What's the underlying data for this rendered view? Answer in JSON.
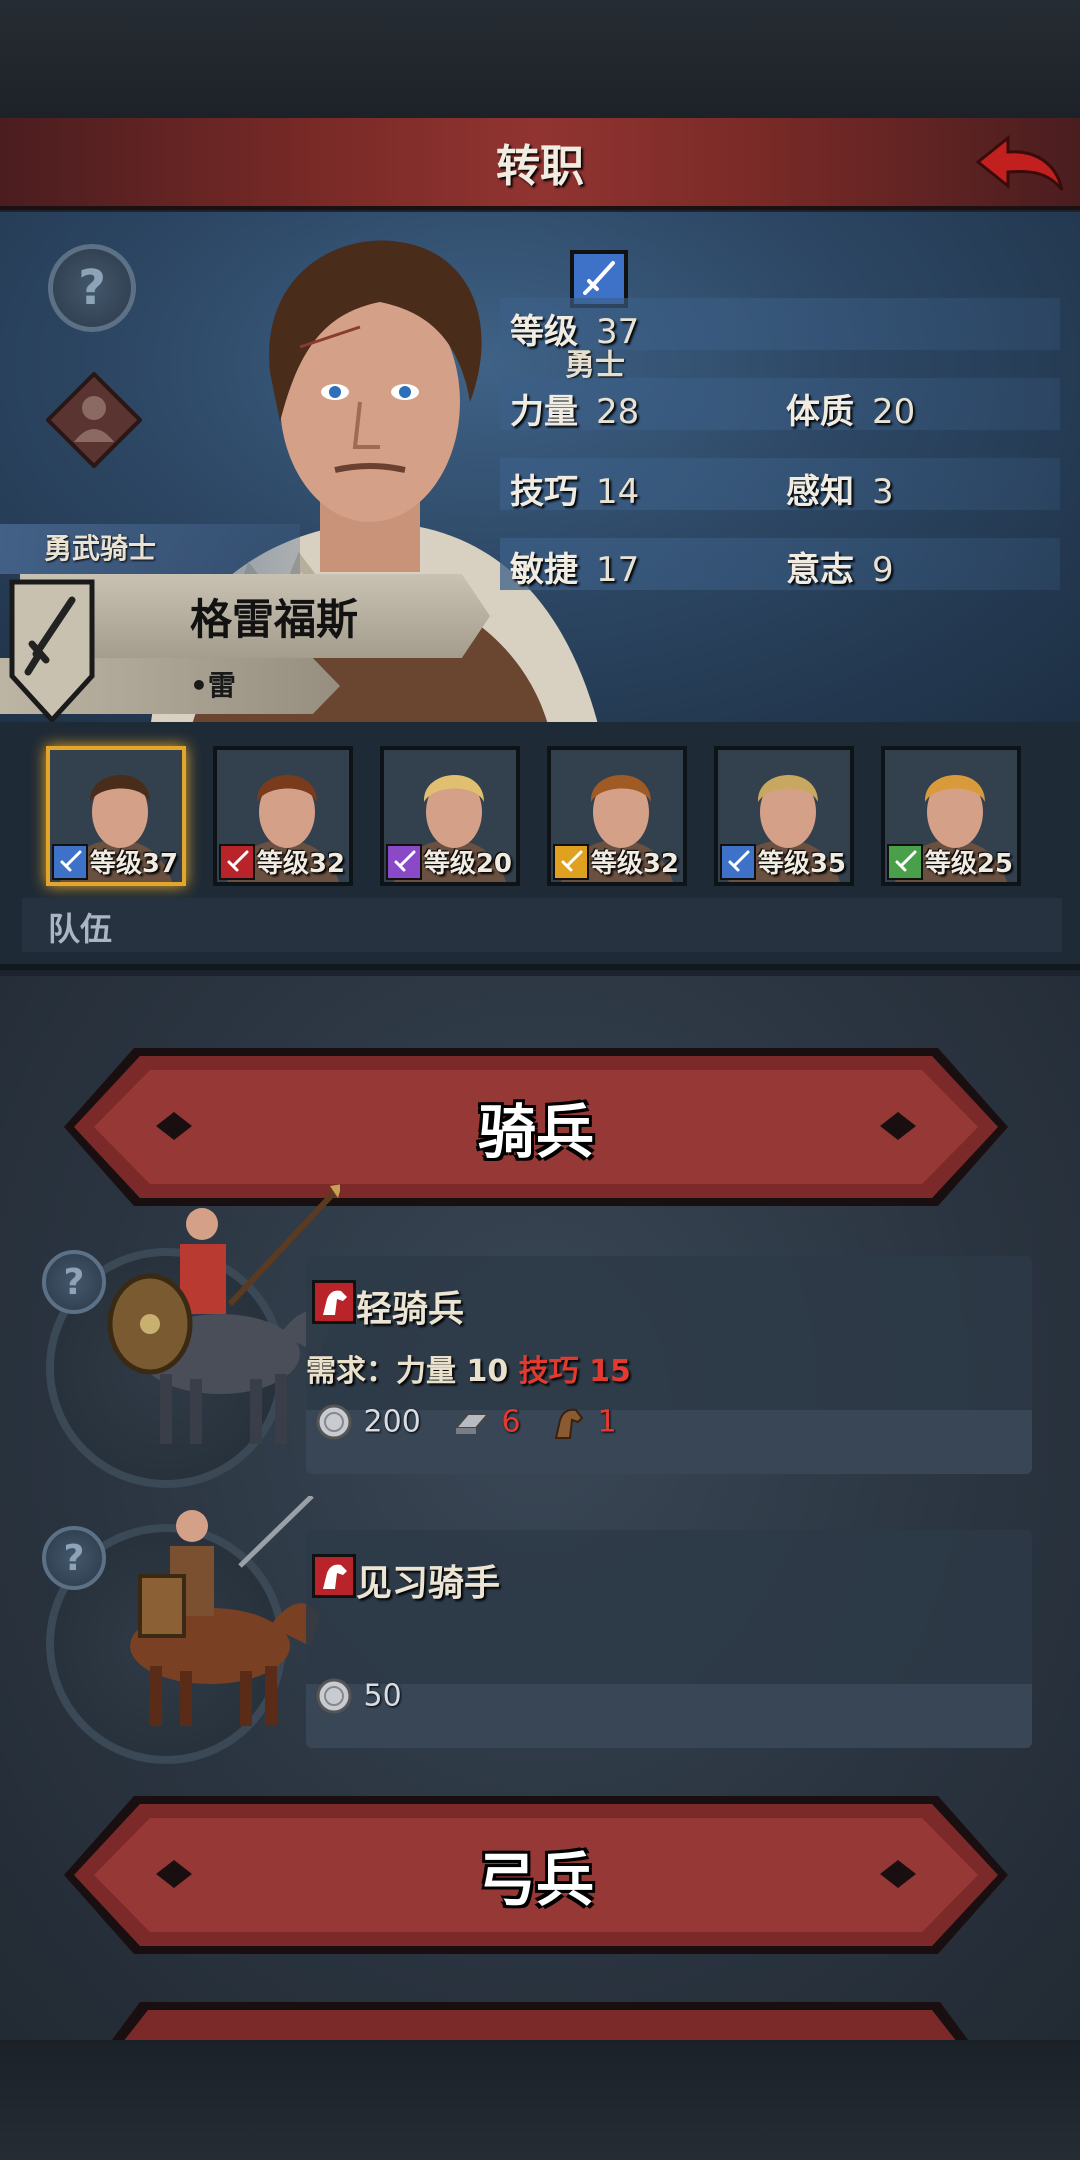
{
  "header": {
    "title": "转职"
  },
  "hero": {
    "class_name": "勇士",
    "title": "勇武骑士",
    "name": "格雷福斯",
    "nickname": "•雷",
    "stats": [
      {
        "label": "等级",
        "value": "37"
      },
      {
        "label": "力量",
        "value": "28"
      },
      {
        "label": "体质",
        "value": "20"
      },
      {
        "label": "技巧",
        "value": "14"
      },
      {
        "label": "感知",
        "value": "3"
      },
      {
        "label": "敏捷",
        "value": "17"
      },
      {
        "label": "意志",
        "value": "9"
      }
    ]
  },
  "team": {
    "label": "队伍",
    "members": [
      {
        "level": "等级37",
        "class_color": "#3d72c8",
        "hair": "#4a2c1a",
        "selected": true
      },
      {
        "level": "等级32",
        "class_color": "#b8242a",
        "hair": "#7a3a1c",
        "selected": false
      },
      {
        "level": "等级20",
        "class_color": "#8a4ac8",
        "hair": "#e0c070",
        "selected": false
      },
      {
        "level": "等级32",
        "class_color": "#e0a020",
        "hair": "#a05a24",
        "selected": false
      },
      {
        "level": "等级35",
        "class_color": "#3d72c8",
        "hair": "#c8a860",
        "selected": false
      },
      {
        "level": "等级25",
        "class_color": "#4aa04a",
        "hair": "#d89a3a",
        "selected": false
      }
    ]
  },
  "sections": [
    {
      "title": "骑兵"
    },
    {
      "title": "弓兵"
    }
  ],
  "units": [
    {
      "name": "轻骑兵",
      "req_prefix": "需求：",
      "req_str_label": "力量",
      "req_str_value": "10",
      "req_skill_label": "技巧",
      "req_skill_value": "15",
      "cost_silver": "200",
      "cost_iron": "6",
      "cost_horse": "1"
    },
    {
      "name": "见习骑手",
      "cost_silver": "50"
    }
  ],
  "colors": {
    "accent_red": "#913431",
    "requirement_unmet": "#e33a2f",
    "selected_border": "#e3a52a"
  }
}
